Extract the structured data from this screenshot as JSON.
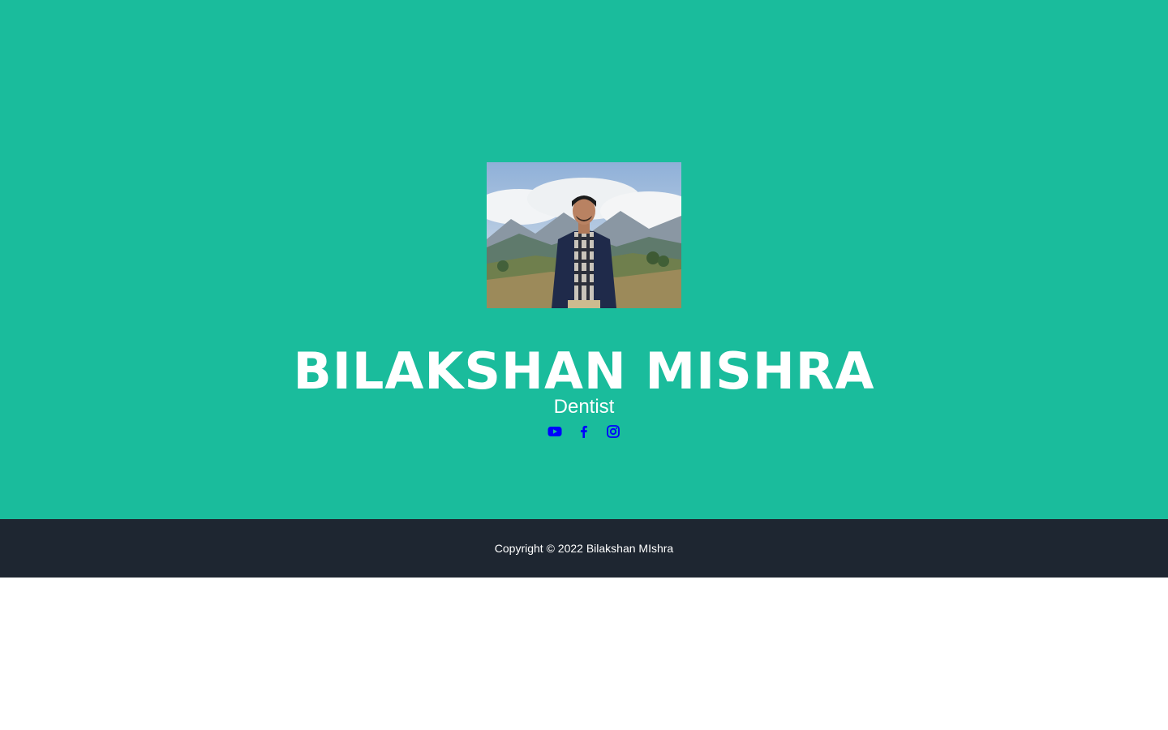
{
  "masthead": {
    "name": "BILAKSHAN MISHRA",
    "subtitle": "Dentist",
    "photo_icon": "profile-photo",
    "socials": [
      {
        "icon": "youtube-icon"
      },
      {
        "icon": "facebook-icon"
      },
      {
        "icon": "instagram-icon"
      }
    ]
  },
  "footer": {
    "copyright": "Copyright © 2022 Bilakshan MIshra"
  },
  "colors": {
    "masthead_bg": "#1abc9c",
    "footer_bg": "#1e2631",
    "link": "#0000ff",
    "text": "#ffffff"
  }
}
